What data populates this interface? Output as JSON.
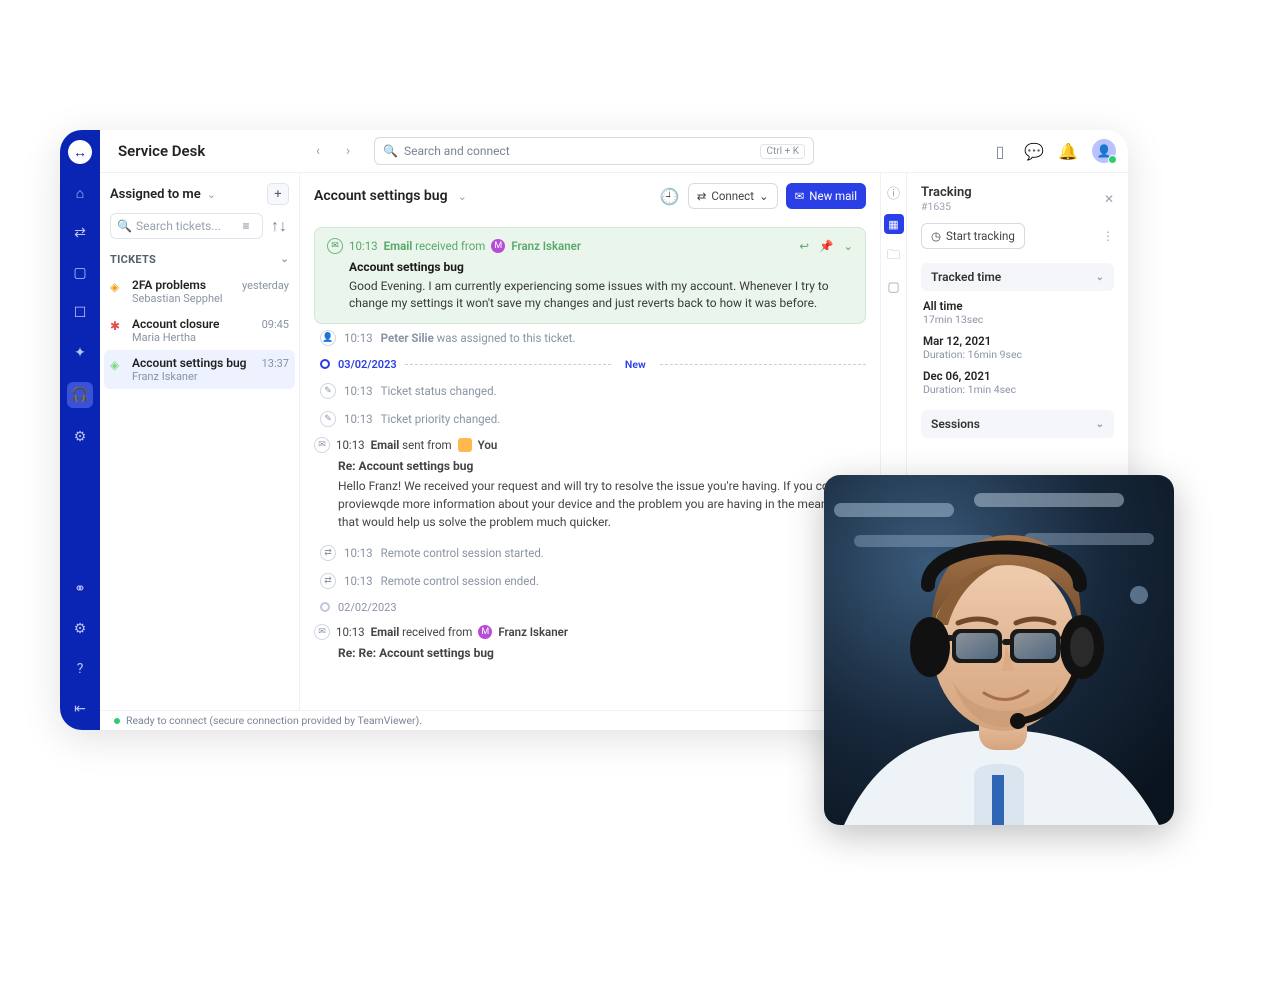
{
  "header": {
    "module_title": "Service Desk",
    "search_placeholder": "Search and connect",
    "search_shortcut": "Ctrl + K"
  },
  "sidebar": {
    "filter_label": "Assigned to me",
    "search_placeholder": "Search tickets...",
    "section_label": "TICKETS",
    "tickets": [
      {
        "icon_color": "#f39c12",
        "title": "2FA problems",
        "time": "yesterday",
        "sub": "Sebastian Sepphel"
      },
      {
        "icon_color": "#e64b4b",
        "title": "Account closure",
        "time": "09:45",
        "sub": "Maria Hertha"
      },
      {
        "icon_color": "#7ed97e",
        "title": "Account settings bug",
        "time": "13:37",
        "sub": "Franz Iskaner"
      }
    ]
  },
  "detail": {
    "title": "Account settings bug",
    "connect_label": "Connect",
    "newmail_label": "New mail",
    "incoming": {
      "time": "10:13",
      "label_email": "Email",
      "label_rest": "received from",
      "from": "Franz Iskaner",
      "subject": "Account settings bug",
      "body": "Good Evening. I am currently experiencing some issues with my account. Whenever I try to change my settings it won't save my changes and just reverts back to how it was before."
    },
    "rows": [
      {
        "time": "10:13",
        "before": "",
        "bold": "Peter Silie",
        "after": " was assigned to this ticket."
      }
    ],
    "sep_date": "03/02/2023",
    "sep_new": "New",
    "rows2": [
      {
        "time": "10:13",
        "text": "Ticket status changed."
      },
      {
        "time": "10:13",
        "text": "Ticket priority changed."
      }
    ],
    "reply": {
      "time": "10:13",
      "label_email": "Email",
      "label_rest": "sent from",
      "you": "You",
      "subject": "Re: Account settings bug",
      "body": "Hello Franz! We received your request and will try to resolve the issue you're having.  If you could proviewqde more information about your device and the problem you are having in the meantime, that would help us solve the problem much quicker."
    },
    "rows3": [
      {
        "time": "10:13",
        "text": "Remote control session started."
      },
      {
        "time": "10:13",
        "text": "Remote control session ended."
      }
    ],
    "sep2_date": "02/02/2023",
    "received2": {
      "time": "10:13",
      "label_email": "Email",
      "label_rest": "received from",
      "from": "Franz Iskaner",
      "subject": "Re: Re: Account settings bug"
    }
  },
  "tracking": {
    "title": "Tracking",
    "id": "#1635",
    "start_label": "Start tracking",
    "section_tracked": "Tracked time",
    "all_time_label": "All time",
    "all_time_value": "17min 13sec",
    "entries": [
      {
        "date": "Mar 12, 2021",
        "dur": "Duration: 16min 9sec"
      },
      {
        "date": "Dec 06, 2021",
        "dur": "Duration: 1min 4sec"
      }
    ],
    "section_sessions": "Sessions"
  },
  "status": "Ready to connect (secure connection provided by TeamViewer)."
}
